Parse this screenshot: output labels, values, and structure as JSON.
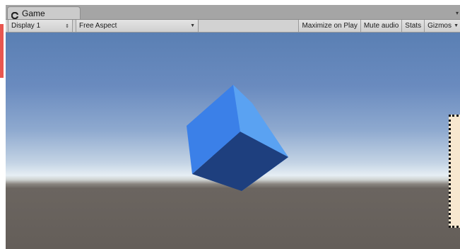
{
  "window": {
    "tab_title": "Game",
    "tab_icon": "unity-logo-icon",
    "pane_menu_icon": "pane-options-icon"
  },
  "toolbar": {
    "display_value": "Display 1",
    "aspect_value": "Free Aspect",
    "maximize_label": "Maximize on Play",
    "mute_label": "Mute audio",
    "stats_label": "Stats",
    "gizmos_label": "Gizmos"
  },
  "scene": {
    "object": "cube",
    "cube_color": "#3a7fe6",
    "sky_top_color": "#5a7fb3",
    "horizon_color": "#e6eef4",
    "ground_color": "#645e59"
  },
  "colors": {
    "accent_red": "#e8564f",
    "side_panel": "#f7e7cf"
  }
}
